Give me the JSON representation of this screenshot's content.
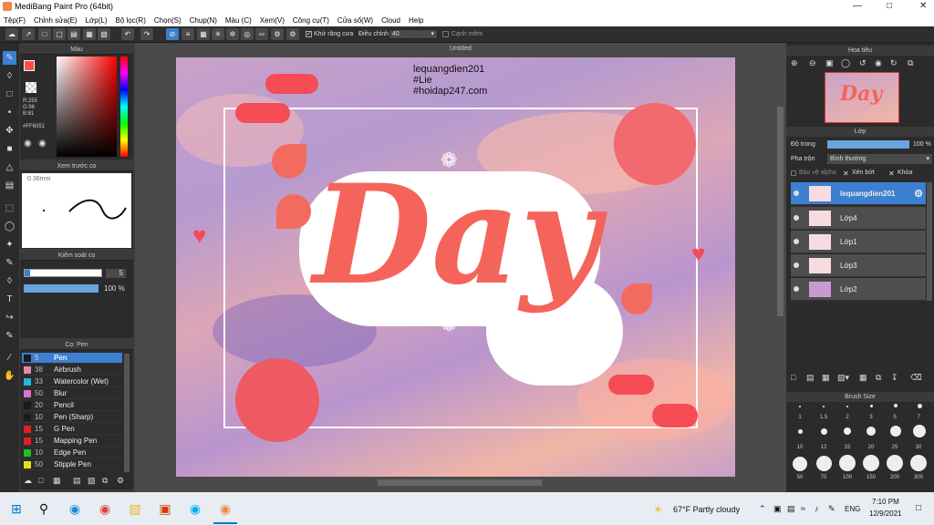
{
  "window": {
    "title": "MediBang Paint Pro (64bit)"
  },
  "menu": [
    "Tệp(F)",
    "Chỉnh sửa(E)",
    "Lớp(L)",
    "Bộ lọc(R)",
    "Chọn(S)",
    "Chụp(N)",
    "Màu (C)",
    "Xem(V)",
    "Công cụ(T)",
    "Cửa sổ(W)",
    "Cloud",
    "Help"
  ],
  "toolbar": {
    "antialias_label": "Khử răng cưa",
    "adjust_label": "Điều chỉnh",
    "adjust_value": "40",
    "smooth_label": "Cạnh mềm"
  },
  "color_panel": {
    "title": "Màu",
    "rgb": "R:255\nG:96\nB:81",
    "hex": "#FF6051",
    "primary": "#ff4f45"
  },
  "preview_panel": {
    "title": "Xem trước cọ",
    "size": "0.36mm"
  },
  "brush_control": {
    "title": "Kiểm soát cọ",
    "size_value": "5",
    "opacity_value": "100 %"
  },
  "brush_panel": {
    "title": "Cọ: Pen",
    "items": [
      {
        "size": "5",
        "name": "Pen",
        "color": "#1a1a1a"
      },
      {
        "size": "38",
        "name": "Airbrush",
        "color": "#e88aa0"
      },
      {
        "size": "33",
        "name": "Watercolor (Wet)",
        "color": "#1fb8e0"
      },
      {
        "size": "50",
        "name": "Blur",
        "color": "#e070d0"
      },
      {
        "size": "20",
        "name": "Pencil",
        "color": "#1a1a1a"
      },
      {
        "size": "10",
        "name": "Pen (Sharp)",
        "color": "#1a1a1a"
      },
      {
        "size": "15",
        "name": "G Pen",
        "color": "#e02020"
      },
      {
        "size": "15",
        "name": "Mapping Pen",
        "color": "#e02020"
      },
      {
        "size": "10",
        "name": "Edge Pen",
        "color": "#20c020"
      },
      {
        "size": "50",
        "name": "Stipple Pen",
        "color": "#e0e020"
      }
    ]
  },
  "canvas": {
    "tab": "Untitled",
    "caption_line1": "lequangdien201",
    "caption_line2": "#Lie",
    "caption_line3": "#hoidap247.com",
    "art_word": "Day"
  },
  "navigator": {
    "title": "Hoa tiêu"
  },
  "layer_panel": {
    "title": "Lớp",
    "opacity_label": "Độ trong",
    "opacity_value": "100 %",
    "blend_label": "Pha trộn",
    "blend_value": "Bình thường",
    "protect_alpha": "Bảo vệ alpha",
    "clip": "Xén bớt",
    "lock": "Khóa",
    "layers": [
      "lequangdien201",
      "Lớp4",
      "Lớp1",
      "Lớp3",
      "Lớp2"
    ]
  },
  "brush_size_panel": {
    "title": "Brush Size",
    "labels_row1": [
      "1",
      "1.5",
      "2",
      "3",
      "5",
      "7"
    ],
    "labels_row2": [
      "10",
      "12",
      "15",
      "20",
      "25",
      "30"
    ],
    "labels_row3": [
      "50",
      "70",
      "100",
      "150",
      "200",
      "300"
    ]
  },
  "taskbar": {
    "weather": "67°F  Partly cloudy",
    "lang": "ENG",
    "time": "7:10 PM",
    "date": "12/9/2021"
  }
}
